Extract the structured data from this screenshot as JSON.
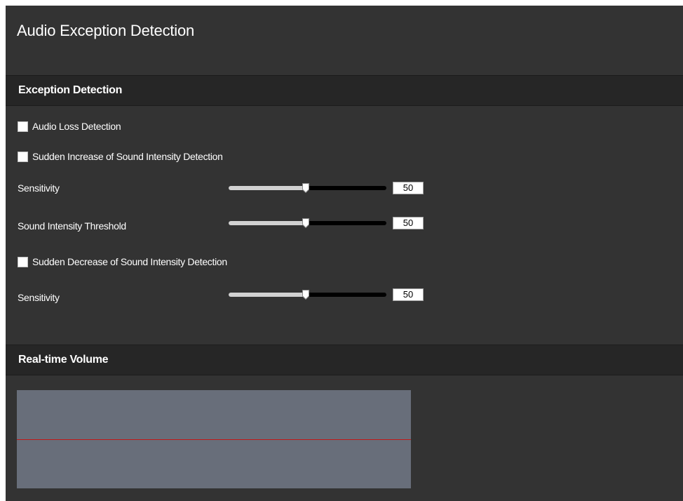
{
  "page": {
    "title": "Audio Exception Detection"
  },
  "exception_section": {
    "header": "Exception Detection",
    "audio_loss": {
      "label": "Audio Loss Detection",
      "checked": false
    },
    "sudden_increase": {
      "label": "Sudden Increase of Sound Intensity Detection",
      "checked": false,
      "sensitivity": {
        "label": "Sensitivity",
        "value": "50",
        "level": 50
      },
      "threshold": {
        "label": "Sound Intensity Threshold",
        "value": "50",
        "level": 50
      }
    },
    "sudden_decrease": {
      "label": "Sudden Decrease of Sound Intensity Detection",
      "checked": false,
      "sensitivity": {
        "label": "Sensitivity",
        "value": "50",
        "level": 50
      }
    }
  },
  "volume_section": {
    "header": "Real-time Volume",
    "threshold_level": 50
  },
  "colors": {
    "panel_background": "#333333",
    "header_background": "#262626",
    "volume_background": "#686e7a",
    "volume_line": "#c01818",
    "slider_fill": "#d2d2d2",
    "slider_track": "#000000"
  }
}
